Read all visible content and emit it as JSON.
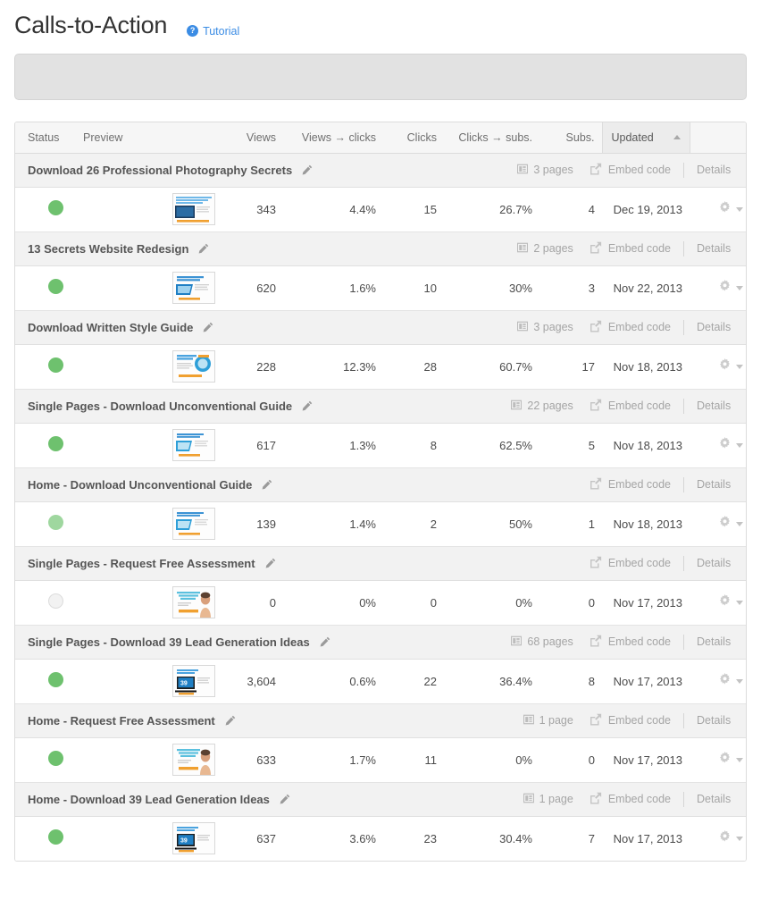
{
  "header": {
    "title": "Calls-to-Action",
    "tutorial_label": "Tutorial",
    "tutorial_icon": "question-circle-icon",
    "accent_color": "#3b8ce4"
  },
  "banner": {
    "text": ""
  },
  "table": {
    "columns": [
      {
        "key": "status",
        "label": "Status"
      },
      {
        "key": "preview",
        "label": "Preview"
      },
      {
        "key": "views",
        "label": "Views"
      },
      {
        "key": "v2c",
        "label": "Views → clicks"
      },
      {
        "key": "clicks",
        "label": "Clicks"
      },
      {
        "key": "c2s",
        "label": "Clicks → subs."
      },
      {
        "key": "subs",
        "label": "Subs."
      },
      {
        "key": "updated",
        "label": "Updated"
      },
      {
        "key": "actions",
        "label": ""
      }
    ],
    "sorted_column": "Updated",
    "sort_direction": "asc",
    "embed_label": "Embed code",
    "details_label": "Details",
    "groups": [
      {
        "title": "Download 26 Professional Photography Secrets",
        "pages": "3 pages",
        "status": "active",
        "thumb": "photography-secrets",
        "views": "343",
        "v2c": "4.4%",
        "clicks": "15",
        "c2s": "26.7%",
        "subs": "4",
        "updated": "Dec 19, 2013"
      },
      {
        "title": "13 Secrets Website Redesign",
        "pages": "2 pages",
        "status": "active",
        "thumb": "website-redesign",
        "views": "620",
        "v2c": "1.6%",
        "clicks": "10",
        "c2s": "30%",
        "subs": "3",
        "updated": "Nov 22, 2013"
      },
      {
        "title": "Download Written Style Guide",
        "pages": "3 pages",
        "status": "active",
        "thumb": "style-guide",
        "views": "228",
        "v2c": "12.3%",
        "clicks": "28",
        "c2s": "60.7%",
        "subs": "17",
        "updated": "Nov 18, 2013"
      },
      {
        "title": "Single Pages - Download Unconventional Guide",
        "pages": "22 pages",
        "status": "active",
        "thumb": "unconventional-guide",
        "views": "617",
        "v2c": "1.3%",
        "clicks": "8",
        "c2s": "62.5%",
        "subs": "5",
        "updated": "Nov 18, 2013"
      },
      {
        "title": "Home - Download Unconventional Guide",
        "pages": "",
        "status": "light",
        "thumb": "unconventional-guide",
        "views": "139",
        "v2c": "1.4%",
        "clicks": "2",
        "c2s": "50%",
        "subs": "1",
        "updated": "Nov 18, 2013"
      },
      {
        "title": "Single Pages - Request Free Assessment",
        "pages": "",
        "status": "inactive",
        "thumb": "free-assessment",
        "views": "0",
        "v2c": "0%",
        "clicks": "0",
        "c2s": "0%",
        "subs": "0",
        "updated": "Nov 17, 2013"
      },
      {
        "title": "Single Pages - Download 39 Lead Generation Ideas",
        "pages": "68 pages",
        "status": "active",
        "thumb": "lead-generation",
        "views": "3,604",
        "v2c": "0.6%",
        "clicks": "22",
        "c2s": "36.4%",
        "subs": "8",
        "updated": "Nov 17, 2013"
      },
      {
        "title": "Home - Request Free Assessment",
        "pages": "1 page",
        "status": "active",
        "thumb": "free-assessment",
        "views": "633",
        "v2c": "1.7%",
        "clicks": "11",
        "c2s": "0%",
        "subs": "0",
        "updated": "Nov 17, 2013"
      },
      {
        "title": "Home - Download 39 Lead Generation Ideas",
        "pages": "1 page",
        "status": "active",
        "thumb": "lead-generation",
        "views": "637",
        "v2c": "3.6%",
        "clicks": "23",
        "c2s": "30.4%",
        "subs": "7",
        "updated": "Nov 17, 2013"
      }
    ]
  },
  "icons": {
    "edit": "pencil-icon",
    "pages": "pages-layout-icon",
    "embed": "external-link-icon",
    "settings": "gear-icon",
    "sort": "sort-asc-caret-icon"
  }
}
